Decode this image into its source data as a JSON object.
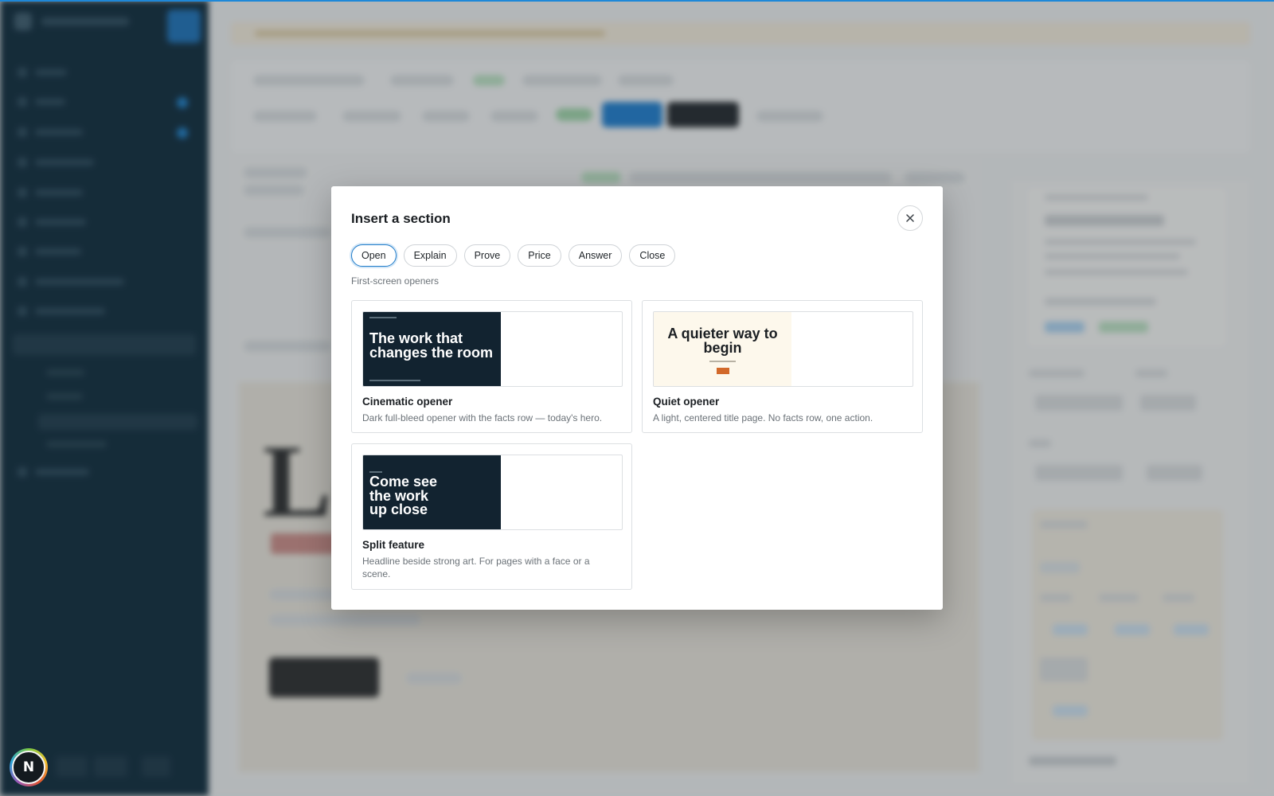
{
  "modal": {
    "title": "Insert a section",
    "close_label": "close",
    "tabs": [
      {
        "label": "Open",
        "active": true
      },
      {
        "label": "Explain",
        "active": false
      },
      {
        "label": "Prove",
        "active": false
      },
      {
        "label": "Price",
        "active": false
      },
      {
        "label": "Answer",
        "active": false
      },
      {
        "label": "Close",
        "active": false
      }
    ],
    "category_caption": "First-screen openers",
    "sections": [
      {
        "title": "Cinematic opener",
        "description": "Dark full-bleed opener with the facts row — today's hero.",
        "preview_text": "The work that changes the room",
        "preview_style": "dark"
      },
      {
        "title": "Quiet opener",
        "description": "A light, centered title page. No facts row, one action.",
        "preview_text": "A quieter way to begin",
        "preview_style": "light"
      },
      {
        "title": "Split feature",
        "description": "Headline beside strong art. For pages with a face or a scene.",
        "preview_text": "Come see the work up close",
        "preview_style": "dark"
      }
    ]
  },
  "user": {
    "avatar_initial": "N"
  },
  "colors": {
    "accent": "#1f7bc9",
    "sidebar": "#0f2a3a",
    "preview_dark": "#122330",
    "preview_light": "#fdf8ec",
    "preview_cta": "#d2692a"
  },
  "icons": {
    "close": "close-icon"
  }
}
